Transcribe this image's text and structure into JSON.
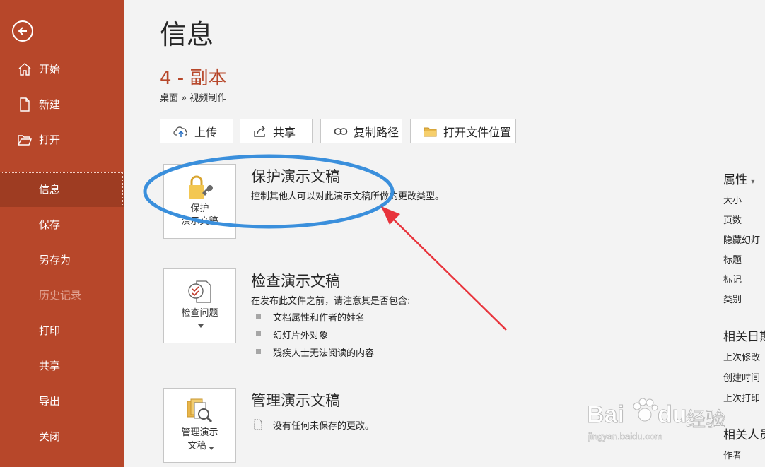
{
  "sidebar": {
    "back_icon": "back-arrow-icon",
    "top_items": [
      {
        "label": "开始",
        "icon": "home-icon"
      },
      {
        "label": "新建",
        "icon": "new-doc-icon"
      },
      {
        "label": "打开",
        "icon": "open-folder-icon"
      }
    ],
    "items": [
      {
        "label": "信息",
        "state": "active"
      },
      {
        "label": "保存"
      },
      {
        "label": "另存为"
      },
      {
        "label": "历史记录",
        "state": "disabled"
      },
      {
        "label": "打印"
      },
      {
        "label": "共享"
      },
      {
        "label": "导出"
      },
      {
        "label": "关闭"
      }
    ]
  },
  "header": {
    "title": "信息",
    "doc_name": "4 - 副本",
    "path": "桌面 » 视频制作"
  },
  "toolbar": {
    "upload": "上传",
    "share": "共享",
    "copy_path": "复制路径",
    "open_location": "打开文件位置"
  },
  "sections": {
    "protect": {
      "card_line1": "保护",
      "card_line2": "演示文稿",
      "title": "保护演示文稿",
      "desc": "控制其他人可以对此演示文稿所做的更改类型。"
    },
    "inspect": {
      "card_line1": "检查问题",
      "title": "检查演示文稿",
      "desc": "在发布此文件之前，请注意其是否包含:",
      "bullets": [
        "文档属性和作者的姓名",
        "幻灯片外对象",
        "残疾人士无法阅读的内容"
      ]
    },
    "manage": {
      "card_line1": "管理演示",
      "card_line2": "文稿",
      "title": "管理演示文稿",
      "desc": "没有任何未保存的更改。"
    }
  },
  "properties": {
    "heading": "属性",
    "items": [
      "大小",
      "页数",
      "隐藏幻灯",
      "标题",
      "标记",
      "类别"
    ],
    "dates_heading": "相关日期",
    "dates": [
      "上次修改",
      "创建时间",
      "上次打印"
    ],
    "people_heading": "相关人员",
    "people": [
      "作者"
    ]
  },
  "watermark": {
    "brand": "Bai",
    "brand2": "du",
    "suffix": "经验",
    "url": "jingyan.baidu.com"
  },
  "colors": {
    "accent": "#b7472a",
    "annotation_ellipse": "#3a8fdc",
    "annotation_arrow": "#e8343c"
  }
}
